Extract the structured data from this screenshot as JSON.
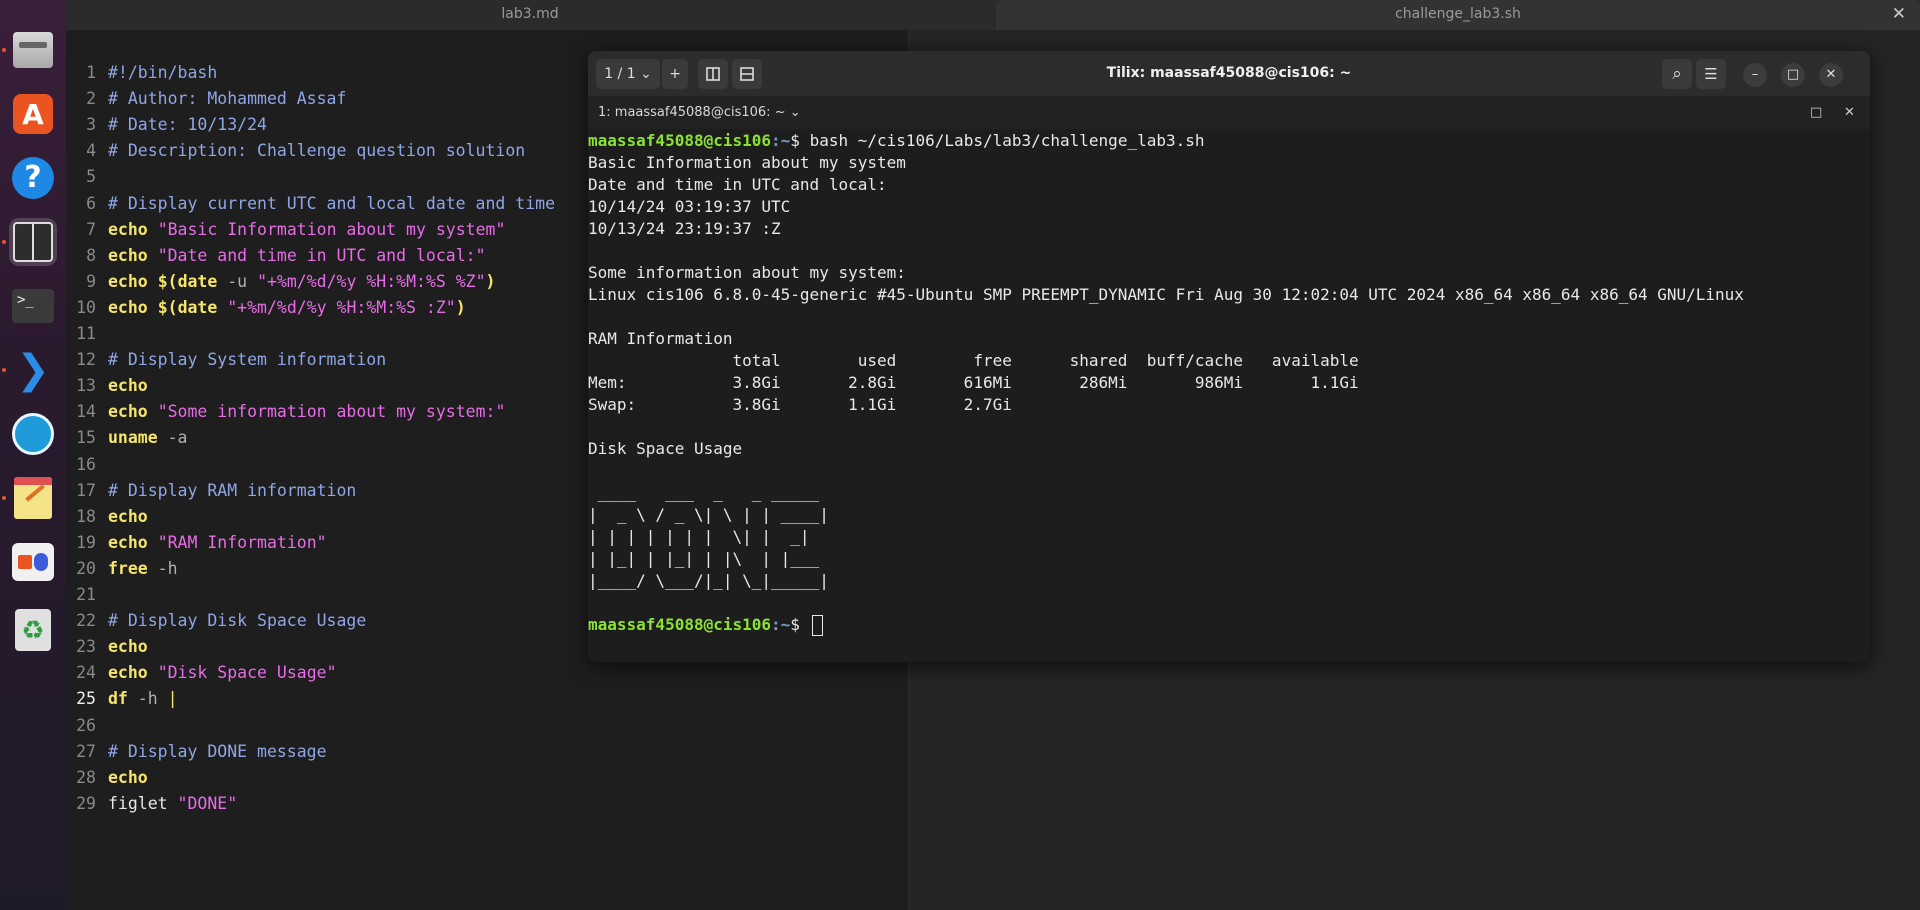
{
  "editor": {
    "tabs": [
      {
        "label": "lab3.md"
      },
      {
        "label": "challenge_lab3.sh"
      }
    ],
    "close_label": "✕",
    "current_line": 25,
    "lines": [
      [
        {
          "t": "#!/bin/bash",
          "c": "cmt"
        }
      ],
      [
        {
          "t": "# Author: Mohammed Assaf",
          "c": "cmt"
        }
      ],
      [
        {
          "t": "# Date: 10/13/24",
          "c": "cmt"
        }
      ],
      [
        {
          "t": "# Description: Challenge question solution",
          "c": "cmt"
        }
      ],
      [],
      [
        {
          "t": "# Display current UTC and local date and time",
          "c": "cmt"
        }
      ],
      [
        {
          "t": "echo",
          "c": "kw"
        },
        {
          "t": " ",
          "c": "pl"
        },
        {
          "t": "\"Basic Information about my system\"",
          "c": "str"
        }
      ],
      [
        {
          "t": "echo",
          "c": "kw"
        },
        {
          "t": " ",
          "c": "pl"
        },
        {
          "t": "\"Date and time in UTC and local:\"",
          "c": "str"
        }
      ],
      [
        {
          "t": "echo",
          "c": "kw"
        },
        {
          "t": " ",
          "c": "pl"
        },
        {
          "t": "$(",
          "c": "kw"
        },
        {
          "t": "date",
          "c": "kw"
        },
        {
          "t": " -u ",
          "c": "opt"
        },
        {
          "t": "\"+%m/%d/%y %H:%M:%S %Z\"",
          "c": "str"
        },
        {
          "t": ")",
          "c": "kw"
        }
      ],
      [
        {
          "t": "echo",
          "c": "kw"
        },
        {
          "t": " ",
          "c": "pl"
        },
        {
          "t": "$(",
          "c": "kw"
        },
        {
          "t": "date",
          "c": "kw"
        },
        {
          "t": " ",
          "c": "pl"
        },
        {
          "t": "\"+%m/%d/%y %H:%M:%S :Z\"",
          "c": "str"
        },
        {
          "t": ")",
          "c": "kw"
        }
      ],
      [],
      [
        {
          "t": "# Display System information",
          "c": "cmt"
        }
      ],
      [
        {
          "t": "echo",
          "c": "kw"
        }
      ],
      [
        {
          "t": "echo",
          "c": "kw"
        },
        {
          "t": " ",
          "c": "pl"
        },
        {
          "t": "\"Some information about my system:\"",
          "c": "str"
        }
      ],
      [
        {
          "t": "uname",
          "c": "kw"
        },
        {
          "t": " -a",
          "c": "opt"
        }
      ],
      [],
      [
        {
          "t": "# Display RAM information",
          "c": "cmt"
        }
      ],
      [
        {
          "t": "echo",
          "c": "kw"
        }
      ],
      [
        {
          "t": "echo",
          "c": "kw"
        },
        {
          "t": " ",
          "c": "pl"
        },
        {
          "t": "\"RAM Information\"",
          "c": "str"
        }
      ],
      [
        {
          "t": "free",
          "c": "kw"
        },
        {
          "t": " -h",
          "c": "opt"
        }
      ],
      [],
      [
        {
          "t": "# Display Disk Space Usage",
          "c": "cmt"
        }
      ],
      [
        {
          "t": "echo",
          "c": "kw"
        }
      ],
      [
        {
          "t": "echo",
          "c": "kw"
        },
        {
          "t": " ",
          "c": "pl"
        },
        {
          "t": "\"Disk Space Usage\"",
          "c": "str"
        }
      ],
      [
        {
          "t": "df",
          "c": "kw"
        },
        {
          "t": " -h ",
          "c": "opt"
        },
        {
          "t": "|",
          "c": "caret"
        }
      ],
      [],
      [
        {
          "t": "# Display DONE message",
          "c": "cmt"
        }
      ],
      [
        {
          "t": "echo",
          "c": "kw"
        }
      ],
      [
        {
          "t": "figlet",
          "c": "pl"
        },
        {
          "t": " ",
          "c": "pl"
        },
        {
          "t": "\"DONE\"",
          "c": "str"
        }
      ]
    ]
  },
  "tilix": {
    "title": "Tilix: maassaf45088@cis106: ~",
    "session_selector": "1 / 1",
    "chevron": "⌄",
    "add_label": "+",
    "session_label": "1: maassaf45088@cis106: ~",
    "session_chevron": "⌄",
    "minimize_label": "–",
    "maximize_label": "□",
    "close_label": "✕",
    "search_label": "⌕",
    "menu_label": "☰",
    "pane_maximize_label": "□",
    "pane_close_label": "✕",
    "terminal": {
      "prompt_user": "maassaf45088@cis106",
      "prompt_path": ":~",
      "prompt_symbol": "$ ",
      "command": "bash ~/cis106/Labs/lab3/challenge_lab3.sh",
      "output": [
        "Basic Information about my system",
        "Date and time in UTC and local:",
        "10/14/24 03:19:37 UTC",
        "10/13/24 23:19:37 :Z",
        "",
        "Some information about my system:",
        "Linux cis106 6.8.0-45-generic #45-Ubuntu SMP PREEMPT_DYNAMIC Fri Aug 30 12:02:04 UTC 2024 x86_64 x86_64 x86_64 GNU/Linux",
        "",
        "RAM Information",
        "               total        used        free      shared  buff/cache   available",
        "Mem:           3.8Gi       2.8Gi       616Mi       286Mi       986Mi       1.1Gi",
        "Swap:          3.8Gi       1.1Gi       2.7Gi",
        "",
        "Disk Space Usage",
        "",
        " ____   ___  _   _ _____",
        "|  _ \\ / _ \\| \\ | | ____|",
        "| | | | | | |  \\| |  _|",
        "| |_| | |_| | |\\  | |___",
        "|____/ \\___/|_| \\_|_____|",
        ""
      ]
    }
  },
  "dock": {
    "items": [
      {
        "name": "files-icon",
        "interactive": true
      },
      {
        "name": "app-center-icon",
        "interactive": true
      },
      {
        "name": "help-icon",
        "interactive": true
      },
      {
        "name": "tilix-icon",
        "interactive": true
      },
      {
        "name": "terminal-icon",
        "interactive": true
      },
      {
        "name": "vscode-icon",
        "interactive": true
      },
      {
        "name": "browser-icon",
        "interactive": true
      },
      {
        "name": "text-editor-icon",
        "interactive": true
      },
      {
        "name": "snap-store-icon",
        "interactive": true
      },
      {
        "name": "trash-icon",
        "interactive": true
      }
    ],
    "terminal_glyph": ">_",
    "store_glyph": "A",
    "help_glyph": "?",
    "vscode_glyph": "❯",
    "trash_glyph": "♻"
  }
}
